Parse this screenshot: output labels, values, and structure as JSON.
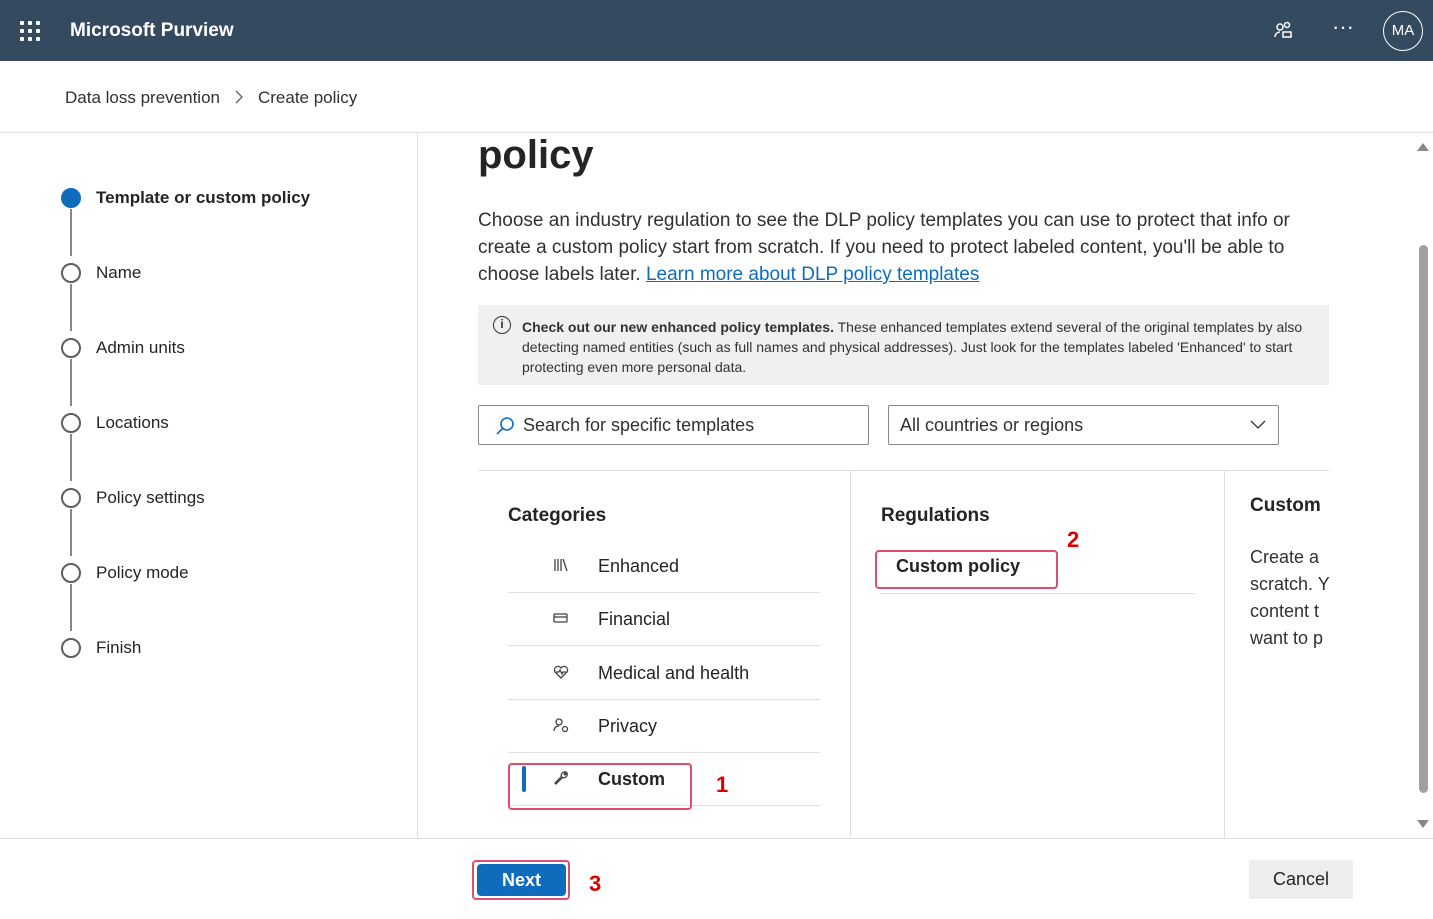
{
  "header": {
    "app_title": "Microsoft Purview",
    "more_label": "···",
    "avatar_initials": "MA"
  },
  "breadcrumb": {
    "items": [
      "Data loss prevention",
      "Create policy"
    ],
    "separator": ">"
  },
  "stepper": {
    "steps": [
      {
        "label": "Template or custom policy",
        "active": true
      },
      {
        "label": "Name",
        "active": false
      },
      {
        "label": "Admin units",
        "active": false
      },
      {
        "label": "Locations",
        "active": false
      },
      {
        "label": "Policy settings",
        "active": false
      },
      {
        "label": "Policy mode",
        "active": false
      },
      {
        "label": "Finish",
        "active": false
      }
    ]
  },
  "main": {
    "heading": "policy",
    "description": "Choose an industry regulation to see the DLP policy templates you can use to protect that info or create a custom policy start from scratch. If you need to protect labeled content, you'll be able to choose labels later.",
    "learn_more_link": "Learn more about DLP policy templates",
    "info": {
      "bold": "Check out our new enhanced policy templates.",
      "text": " These enhanced templates extend several of the original templates by also detecting named entities (such as full names and physical addresses). Just look for the templates labeled 'Enhanced' to start protecting even more personal data."
    },
    "search": {
      "placeholder": "Search for specific templates"
    },
    "region_dropdown": {
      "selected": "All countries or regions"
    },
    "categories": {
      "heading": "Categories",
      "items": [
        {
          "label": "Enhanced",
          "icon": "books-icon"
        },
        {
          "label": "Financial",
          "icon": "card-icon"
        },
        {
          "label": "Medical and health",
          "icon": "heart-icon"
        },
        {
          "label": "Privacy",
          "icon": "person-icon"
        },
        {
          "label": "Custom",
          "icon": "wrench-icon",
          "selected": true
        }
      ]
    },
    "regulations": {
      "heading": "Regulations",
      "items": [
        {
          "label": "Custom policy"
        }
      ]
    },
    "detail": {
      "heading": "Custom",
      "lines": [
        "Create a",
        "scratch. Y",
        "content t",
        "want to p"
      ]
    }
  },
  "annotations": {
    "one": "1",
    "two": "2",
    "three": "3"
  },
  "footer": {
    "next_label": "Next",
    "cancel_label": "Cancel"
  },
  "colors": {
    "topbar": "#344a5e",
    "accent": "#0f6cbd",
    "highlight": "#e04e6e",
    "annotation": "#e00000"
  }
}
